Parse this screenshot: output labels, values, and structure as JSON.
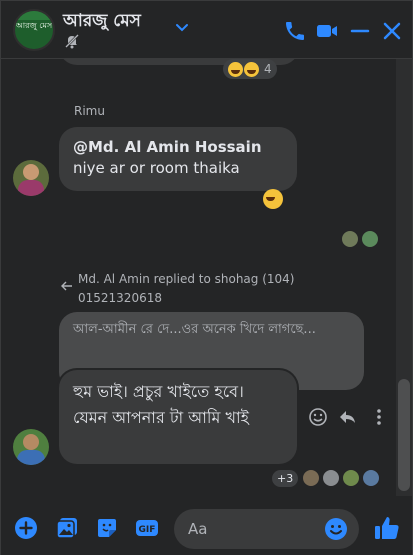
{
  "header": {
    "title": "আরজু মেস",
    "group_avatar_text": "আরজু মেস"
  },
  "previous_message": {
    "reaction_count": "4"
  },
  "message_rimu": {
    "sender": "Rimu",
    "mention": "@Md. Al Amin Hossain",
    "text": "niye ar or room thaika"
  },
  "reply": {
    "header": "Md. Al Amin replied to shohag (104) 01521320618",
    "quoted_text": "আল-আমীন রে দে...ওর অনেক খিদে লাগছে...",
    "text": "হুম ভাই। প্রচুর খাইতে হবে। যেমন আপনার টা আমি খাই"
  },
  "seen": {
    "extra_count": "+3"
  },
  "composer": {
    "placeholder": "Aa"
  },
  "colors": {
    "accent": "#2e89ff",
    "background": "#242526",
    "bubble": "#3a3b3c"
  }
}
